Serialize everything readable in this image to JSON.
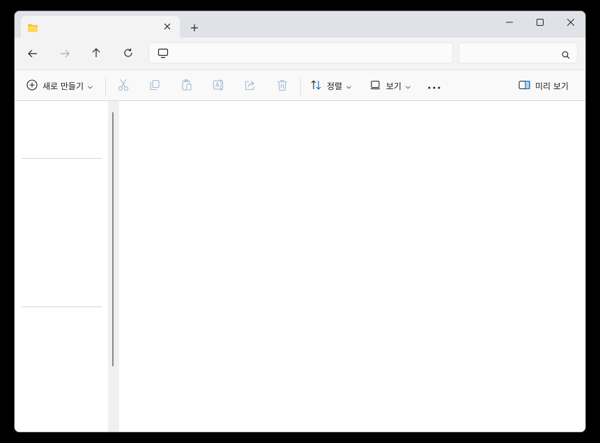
{
  "window": {
    "tab_title": "",
    "close_tab_icon": "close-icon",
    "new_tab_icon": "plus-icon",
    "controls": [
      "minimize-icon",
      "maximize-icon",
      "close-icon"
    ]
  },
  "navigation": {
    "buttons": [
      "back-arrow-icon",
      "forward-arrow-icon",
      "up-arrow-icon",
      "refresh-icon"
    ],
    "address_value": "",
    "address_icon": "this-pc-icon",
    "search_placeholder": "",
    "search_icon": "search-icon"
  },
  "commandbar": {
    "new_label": "새로 만들기",
    "sort_label": "정렬",
    "view_label": "보기",
    "preview_label": "미리 보기",
    "disabled_actions": [
      "cut-icon",
      "copy-icon",
      "paste-icon",
      "rename-icon",
      "share-icon",
      "delete-icon"
    ]
  },
  "colors": {
    "titlebar": "#dfe3e8",
    "accent": "#0067c0",
    "folder": "#f4c542"
  }
}
